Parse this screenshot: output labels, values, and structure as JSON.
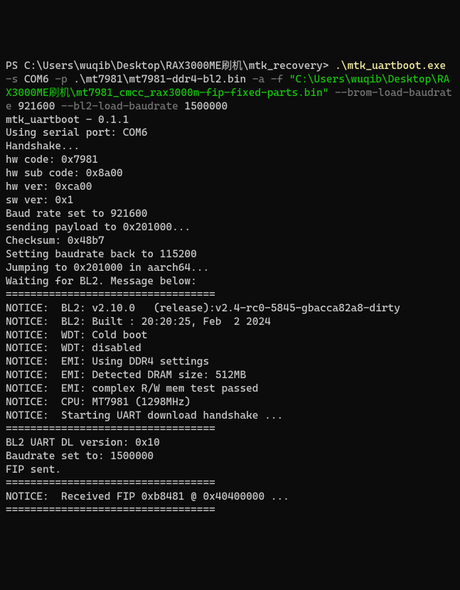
{
  "cmd": {
    "prompt": "PS C:\\Users\\wuqib\\Desktop\\RAX3000ME刷机\\mtk_recovery> ",
    "exec": ".\\mtk_uartboot.exe",
    "flag_s": "-s",
    "arg_s": "COM6",
    "flag_p": "-p",
    "arg_p": ".\\mt7981\\mt7981-ddr4-bl2.bin",
    "flag_a": "-a",
    "flag_f": "-f",
    "arg_f": "\"C:\\Users\\wuqib\\Desktop\\RAX3000ME刷机\\mt7981_cmcc_rax3000m-fip-fixed-parts.bin\"",
    "flag_brom": "--brom-load-baudrate",
    "arg_brom": "921600",
    "flag_bl2": "--bl2-load-baudrate",
    "arg_bl2": "1500000"
  },
  "out": {
    "l01": "mtk_uartboot - 0.1.1",
    "l02": "Using serial port: COM6",
    "l03": "Handshake...",
    "l04": "hw code: 0x7981",
    "l05": "hw sub code: 0x8a00",
    "l06": "hw ver: 0xca00",
    "l07": "sw ver: 0x1",
    "l08": "Baud rate set to 921600",
    "l09": "sending payload to 0x201000...",
    "l10": "Checksum: 0x48b7",
    "l11": "Setting baudrate back to 115200",
    "l12": "Jumping to 0x201000 in aarch64...",
    "l13": "Waiting for BL2. Message below:",
    "l14": "==================================",
    "l15": "NOTICE:  BL2: v2.10.0   (release):v2.4-rc0-5845-gbacca82a8-dirty",
    "l16": "NOTICE:  BL2: Built : 20:20:25, Feb  2 2024",
    "l17": "NOTICE:  WDT: Cold boot",
    "l18": "NOTICE:  WDT: disabled",
    "l19": "NOTICE:  EMI: Using DDR4 settings",
    "l20": "NOTICE:  EMI: Detected DRAM size: 512MB",
    "l21": "NOTICE:  EMI: complex R/W mem test passed",
    "l22": "NOTICE:  CPU: MT7981 (1298MHz)",
    "l23": "NOTICE:  Starting UART download handshake ...",
    "l24": "==================================",
    "l25": "BL2 UART DL version: 0x10",
    "l26": "Baudrate set to: 1500000",
    "l27": "FIP sent.",
    "l28": "==================================",
    "l29": "NOTICE:  Received FIP 0xb8481 @ 0x40400000 ...",
    "l30": "=================================="
  }
}
